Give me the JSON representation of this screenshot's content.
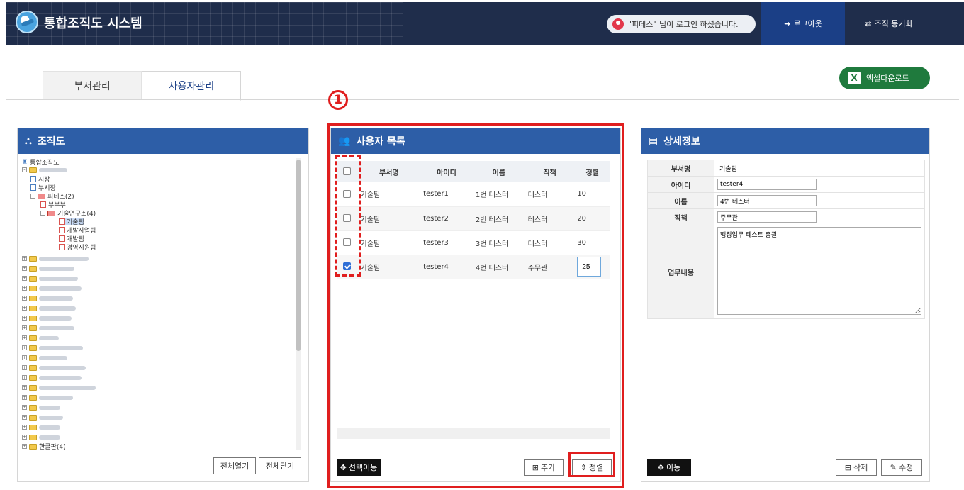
{
  "header": {
    "app_title": "통합조직도 시스템",
    "login_message": "\"피데스\" 님이 로그인 하셨습니다.",
    "logout_label": "로그아웃",
    "sync_label": "조직 동기화"
  },
  "tabs": [
    {
      "label": "부서관리",
      "active": false
    },
    {
      "label": "사용자관리",
      "active": true
    }
  ],
  "excel_download_label": "엑셀다운로드",
  "callout_number": "1",
  "org_panel": {
    "title": "조직도",
    "root_label": "통합조직도",
    "items": [
      "시장",
      "부시장",
      "피데스(2)",
      "부부부",
      "기술연구소(4)",
      "기술팀",
      "개발사업팀",
      "개발팀",
      "경영지원팀",
      "한글판(4)"
    ],
    "expand_all_label": "전체열기",
    "collapse_all_label": "전체닫기"
  },
  "user_list": {
    "title": "사용자 목록",
    "columns": [
      "부서명",
      "아이디",
      "이름",
      "직책",
      "정렬"
    ],
    "rows": [
      {
        "dept": "기술팀",
        "id": "tester1",
        "name": "1번 테스터",
        "position": "테스터",
        "order": "10",
        "checked": false
      },
      {
        "dept": "기술팀",
        "id": "tester2",
        "name": "2번 테스터",
        "position": "테스터",
        "order": "20",
        "checked": false
      },
      {
        "dept": "기술팀",
        "id": "tester3",
        "name": "3번 테스터",
        "position": "테스터",
        "order": "30",
        "checked": false
      },
      {
        "dept": "기술팀",
        "id": "tester4",
        "name": "4번 테스터",
        "position": "주무관",
        "order": "25",
        "checked": true
      }
    ],
    "move_selected_label": "선택이동",
    "add_label": "추가",
    "sort_label": "정렬"
  },
  "detail_panel": {
    "title": "상세정보",
    "fields": {
      "dept_label": "부서명",
      "dept_value": "기술팀",
      "id_label": "아이디",
      "id_value": "tester4",
      "name_label": "이름",
      "name_value": "4번 테스터",
      "position_label": "직책",
      "position_value": "주무관",
      "duty_label": "업무내용",
      "duty_value": "행정업무 테스트 총괄"
    },
    "move_label": "이동",
    "delete_label": "삭제",
    "edit_label": "수정"
  },
  "colors": {
    "header_bg": "#1f2d4b",
    "panel_header": "#2d5ea7",
    "logout_bg": "#1b3f86",
    "excel_green": "#1f7a3d",
    "highlight_red": "#e01e1e"
  }
}
